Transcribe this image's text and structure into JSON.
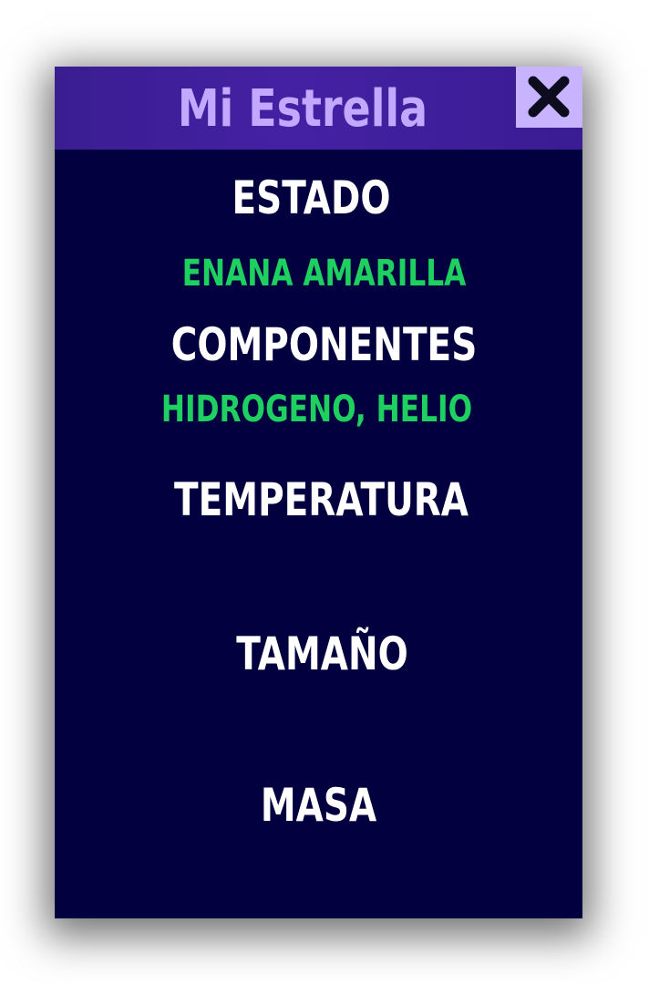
{
  "window": {
    "title": "Mi Estrella",
    "close_icon": "close-icon"
  },
  "fields": {
    "estado_label": "ESTADO",
    "estado_value": "ENANA AMARILLA",
    "componentes_label": "COMPONENTES",
    "componentes_value": "HIDROGENO, HELIO",
    "temperatura_label": "TEMPERATURA",
    "tamano_label": "TAMAÑO",
    "masa_label": "MASA"
  },
  "colors": {
    "background": "#03003f",
    "titlebar": "#4421a3",
    "title_text": "#c3a8ff",
    "close_button": "#c7b3ff",
    "heading_text": "#ffffff",
    "value_text": "#1ed05f"
  }
}
